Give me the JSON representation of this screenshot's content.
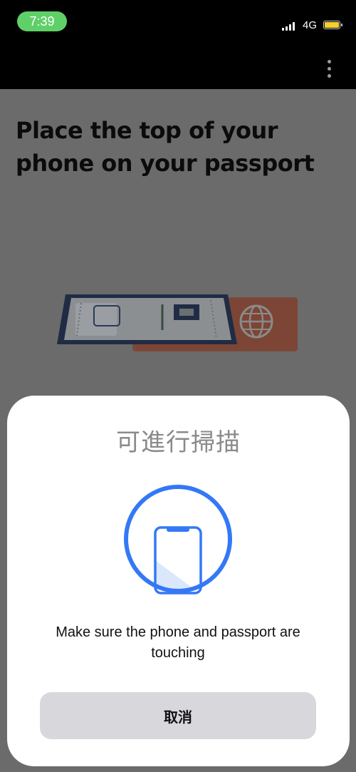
{
  "status_bar": {
    "time": "7:39",
    "network": "4G",
    "time_pill_color": "#5fd068",
    "battery_color": "#f5cf2e"
  },
  "app_bar": {
    "menu_icon": "more-vertical-icon"
  },
  "page": {
    "title": "Place the top of your phone on your passport",
    "illustration_icon": "phone-on-passport-illustration"
  },
  "scan_sheet": {
    "title": "可進行掃描",
    "icon": "phone-scan-icon",
    "accent_color": "#3478f6",
    "instruction": "Make sure the phone and passport are touching",
    "cancel_label": "取消"
  }
}
